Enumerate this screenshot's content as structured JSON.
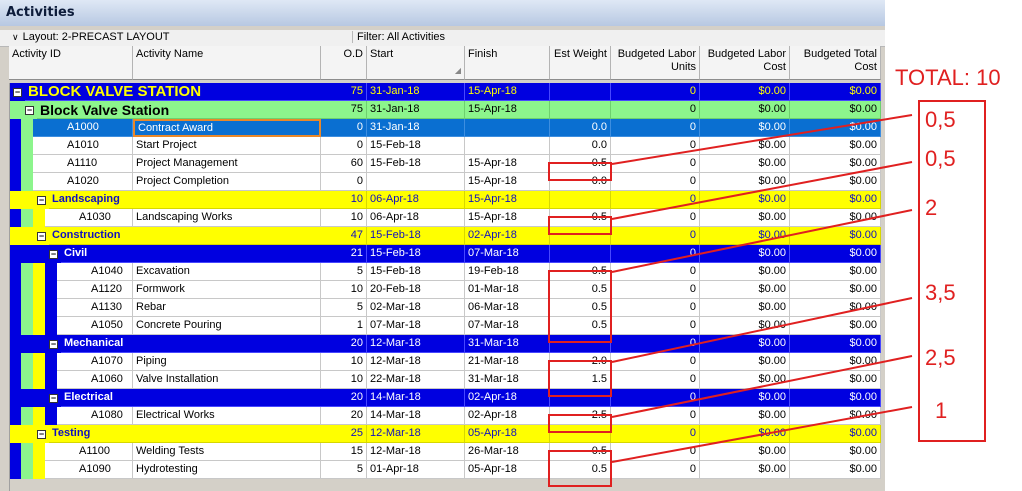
{
  "window": {
    "title": "Activities"
  },
  "toolbar": {
    "layout": "Layout: 2-PRECAST LAYOUT",
    "filter": "Filter: All Activities"
  },
  "columns": {
    "id": "Activity ID",
    "name": "Activity Name",
    "od": "O.D",
    "start": "Start",
    "finish": "Finish",
    "weight": "Est Weight",
    "units_1": "Budgeted Labor",
    "units_2": "Units",
    "cost_1": "Budgeted Labor",
    "cost_2": "Cost",
    "total_1": "Budgeted Total",
    "total_2": "Cost"
  },
  "rows": [
    {
      "kind": "wbs1",
      "name": "BLOCK VALVE STATION",
      "od": "75",
      "start": "31-Jan-18",
      "finish": "15-Apr-18",
      "weight": "",
      "units": "0",
      "cost": "$0.00",
      "total": "$0.00"
    },
    {
      "kind": "wbs2",
      "name": "Block Valve Station",
      "od": "75",
      "start": "31-Jan-18",
      "finish": "15-Apr-18",
      "weight": "",
      "units": "0",
      "cost": "$0.00",
      "total": "$0.00"
    },
    {
      "kind": "sel",
      "id": "A1000",
      "name": "Contract Award",
      "od": "0",
      "start": "31-Jan-18",
      "finish": "",
      "weight": "0.0",
      "units": "0",
      "cost": "$0.00",
      "total": "$0.00"
    },
    {
      "kind": "act",
      "id": "A1010",
      "name": "Start Project",
      "od": "0",
      "start": "15-Feb-18",
      "finish": "",
      "weight": "0.0",
      "units": "0",
      "cost": "$0.00",
      "total": "$0.00"
    },
    {
      "kind": "act",
      "id": "A1110",
      "name": "Project Management",
      "od": "60",
      "start": "15-Feb-18",
      "finish": "15-Apr-18",
      "weight": "0.5",
      "units": "0",
      "cost": "$0.00",
      "total": "$0.00"
    },
    {
      "kind": "act",
      "id": "A1020",
      "name": "Project Completion",
      "od": "0",
      "start": "",
      "finish": "15-Apr-18",
      "weight": "0.0",
      "units": "0",
      "cost": "$0.00",
      "total": "$0.00"
    },
    {
      "kind": "wbsY",
      "name": "Landscaping",
      "od": "10",
      "start": "06-Apr-18",
      "finish": "15-Apr-18",
      "weight": "",
      "units": "0",
      "cost": "$0.00",
      "total": "$0.00"
    },
    {
      "kind": "act",
      "id": "A1030",
      "name": "Landscaping Works",
      "od": "10",
      "start": "06-Apr-18",
      "finish": "15-Apr-18",
      "weight": "0.5",
      "units": "0",
      "cost": "$0.00",
      "total": "$0.00"
    },
    {
      "kind": "wbsY",
      "name": "Construction",
      "od": "47",
      "start": "15-Feb-18",
      "finish": "02-Apr-18",
      "weight": "",
      "units": "0",
      "cost": "$0.00",
      "total": "$0.00"
    },
    {
      "kind": "wbsB",
      "name": "Civil",
      "od": "21",
      "start": "15-Feb-18",
      "finish": "07-Mar-18",
      "weight": "",
      "units": "0",
      "cost": "$0.00",
      "total": "$0.00"
    },
    {
      "kind": "act",
      "id": "A1040",
      "name": "Excavation",
      "od": "5",
      "start": "15-Feb-18",
      "finish": "19-Feb-18",
      "weight": "0.5",
      "units": "0",
      "cost": "$0.00",
      "total": "$0.00"
    },
    {
      "kind": "act",
      "id": "A1120",
      "name": "Formwork",
      "od": "10",
      "start": "20-Feb-18",
      "finish": "01-Mar-18",
      "weight": "0.5",
      "units": "0",
      "cost": "$0.00",
      "total": "$0.00"
    },
    {
      "kind": "act",
      "id": "A1130",
      "name": "Rebar",
      "od": "5",
      "start": "02-Mar-18",
      "finish": "06-Mar-18",
      "weight": "0.5",
      "units": "0",
      "cost": "$0.00",
      "total": "$0.00"
    },
    {
      "kind": "act",
      "id": "A1050",
      "name": "Concrete Pouring",
      "od": "1",
      "start": "07-Mar-18",
      "finish": "07-Mar-18",
      "weight": "0.5",
      "units": "0",
      "cost": "$0.00",
      "total": "$0.00"
    },
    {
      "kind": "wbsB",
      "name": "Mechanical",
      "od": "20",
      "start": "12-Mar-18",
      "finish": "31-Mar-18",
      "weight": "",
      "units": "0",
      "cost": "$0.00",
      "total": "$0.00"
    },
    {
      "kind": "act",
      "id": "A1070",
      "name": "Piping",
      "od": "10",
      "start": "12-Mar-18",
      "finish": "21-Mar-18",
      "weight": "2.0",
      "units": "0",
      "cost": "$0.00",
      "total": "$0.00"
    },
    {
      "kind": "act",
      "id": "A1060",
      "name": "Valve Installation",
      "od": "10",
      "start": "22-Mar-18",
      "finish": "31-Mar-18",
      "weight": "1.5",
      "units": "0",
      "cost": "$0.00",
      "total": "$0.00"
    },
    {
      "kind": "wbsB",
      "name": "Electrical",
      "od": "20",
      "start": "14-Mar-18",
      "finish": "02-Apr-18",
      "weight": "",
      "units": "0",
      "cost": "$0.00",
      "total": "$0.00"
    },
    {
      "kind": "act",
      "id": "A1080",
      "name": "Electrical Works",
      "od": "20",
      "start": "14-Mar-18",
      "finish": "02-Apr-18",
      "weight": "2.5",
      "units": "0",
      "cost": "$0.00",
      "total": "$0.00"
    },
    {
      "kind": "wbsY",
      "name": "Testing",
      "od": "25",
      "start": "12-Mar-18",
      "finish": "05-Apr-18",
      "weight": "",
      "units": "0",
      "cost": "$0.00",
      "total": "$0.00"
    },
    {
      "kind": "act",
      "id": "A1100",
      "name": "Welding Tests",
      "od": "15",
      "start": "12-Mar-18",
      "finish": "26-Mar-18",
      "weight": "0.5",
      "units": "0",
      "cost": "$0.00",
      "total": "$0.00"
    },
    {
      "kind": "act",
      "id": "A1090",
      "name": "Hydrotesting",
      "od": "5",
      "start": "01-Apr-18",
      "finish": "05-Apr-18",
      "weight": "0.5",
      "units": "0",
      "cost": "$0.00",
      "total": "$0.00"
    }
  ],
  "annotations": {
    "total": "TOTAL: 10",
    "values": [
      "0,5",
      "0,5",
      "2",
      "3,5",
      "2,5",
      "1"
    ],
    "color": "#e02020"
  },
  "colors": {
    "wbs_blue": "#0000e0",
    "wbs_yellow": "#ffff00",
    "wbs_green": "#8cf58c",
    "selected": "#0a6fd1"
  }
}
